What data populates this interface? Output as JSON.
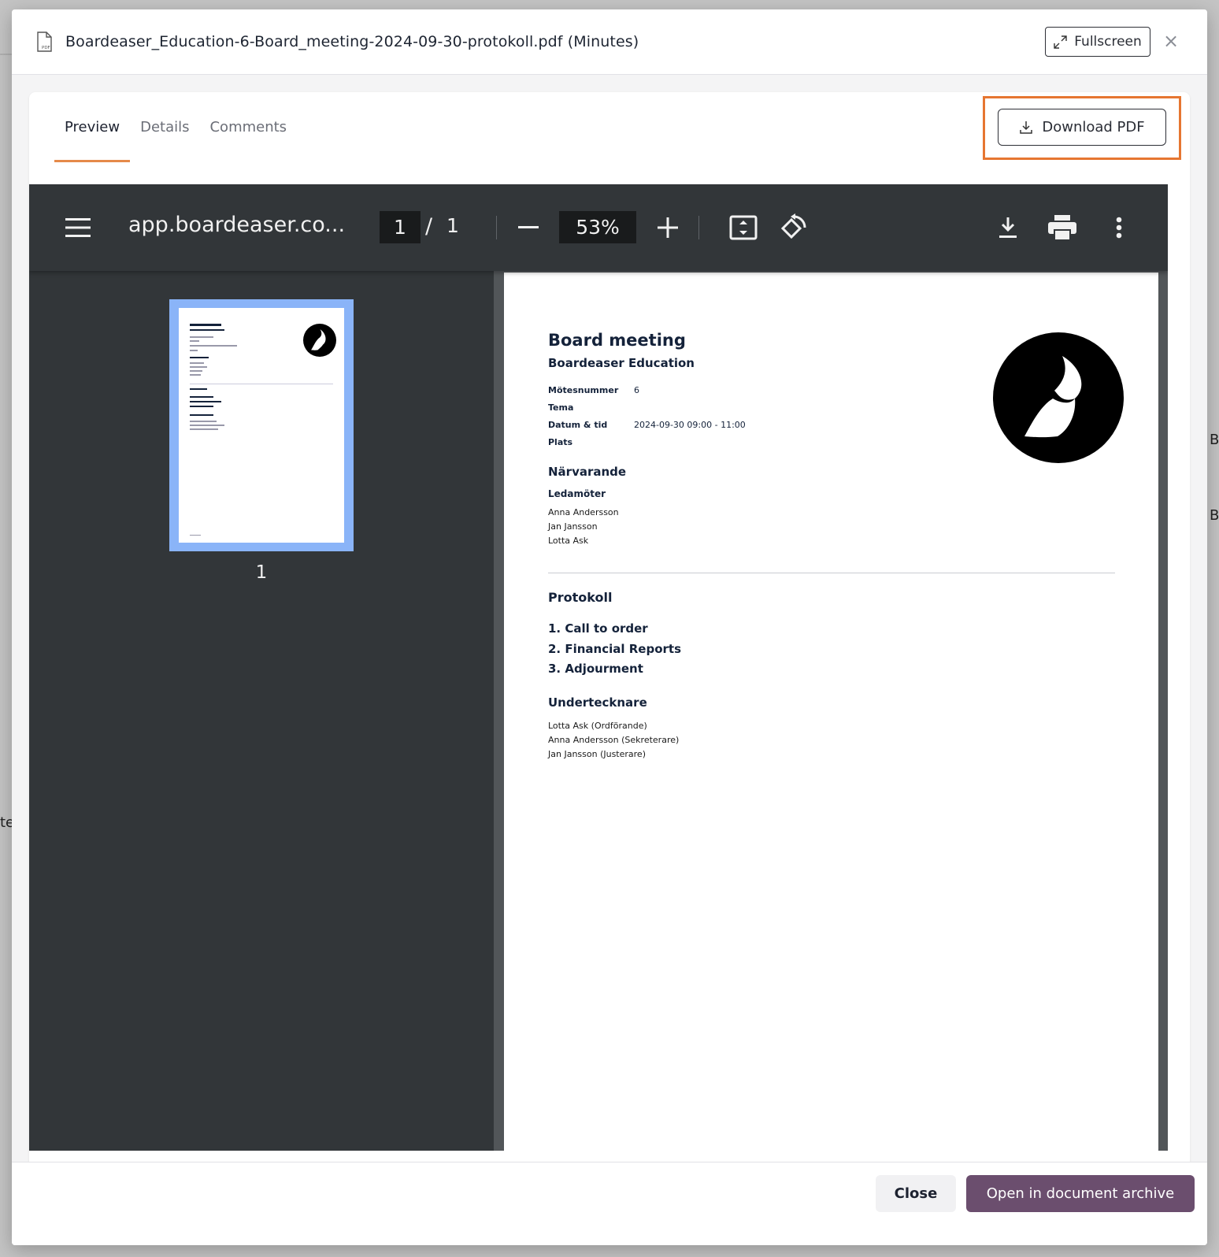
{
  "modal": {
    "title": "Boardeaser_Education-6-Board_meeting-2024-09-30-protokoll.pdf (Minutes)",
    "fullscreen_label": "Fullscreen",
    "close_symbol": "×"
  },
  "tabs": [
    {
      "label": "Preview",
      "active": true
    },
    {
      "label": "Details",
      "active": false
    },
    {
      "label": "Comments",
      "active": false
    }
  ],
  "download_label": "Download PDF",
  "viewer": {
    "title": "app.boardeaser.co...",
    "current_page": "1",
    "separator": "/",
    "total_pages": "1",
    "zoom": "53%",
    "thumbnail_label": "1",
    "icons": [
      "menu-icon",
      "zoom-out-icon",
      "zoom-in-icon",
      "fit-page-icon",
      "rotate-icon",
      "download-icon",
      "print-icon",
      "more-options-icon"
    ]
  },
  "document": {
    "title": "Board meeting",
    "organization": "Boardeaser Education",
    "fields": [
      {
        "label": "Mötesnummer",
        "value": "6"
      },
      {
        "label": "Tema",
        "value": ""
      },
      {
        "label": "Datum & tid",
        "value": "2024-09-30 09:00 - 11:00"
      },
      {
        "label": "Plats",
        "value": ""
      }
    ],
    "attendance_heading": "Närvarande",
    "members_heading": "Ledamöter",
    "members": [
      "Anna Andersson",
      "Jan Jansson",
      "Lotta Ask"
    ],
    "protocol_heading": "Protokoll",
    "agenda": [
      "1. Call to order",
      "2. Financial Reports",
      "3. Adjourment"
    ],
    "signers_heading": "Undertecknare",
    "signers": [
      "Lotta Ask (Ordförande)",
      "Anna Andersson (Sekreterare)",
      "Jan Jansson (Justerare)"
    ]
  },
  "footer": {
    "close_label": "Close",
    "archive_label": "Open in document archive"
  },
  "colors": {
    "accent_tab": "#e58a4a",
    "highlight": "#e67631",
    "archive_button": "#6b4e6e",
    "thumbnail_border": "#8ab4f8"
  },
  "background": {
    "fragments": [
      "te",
      "B",
      "B"
    ]
  }
}
